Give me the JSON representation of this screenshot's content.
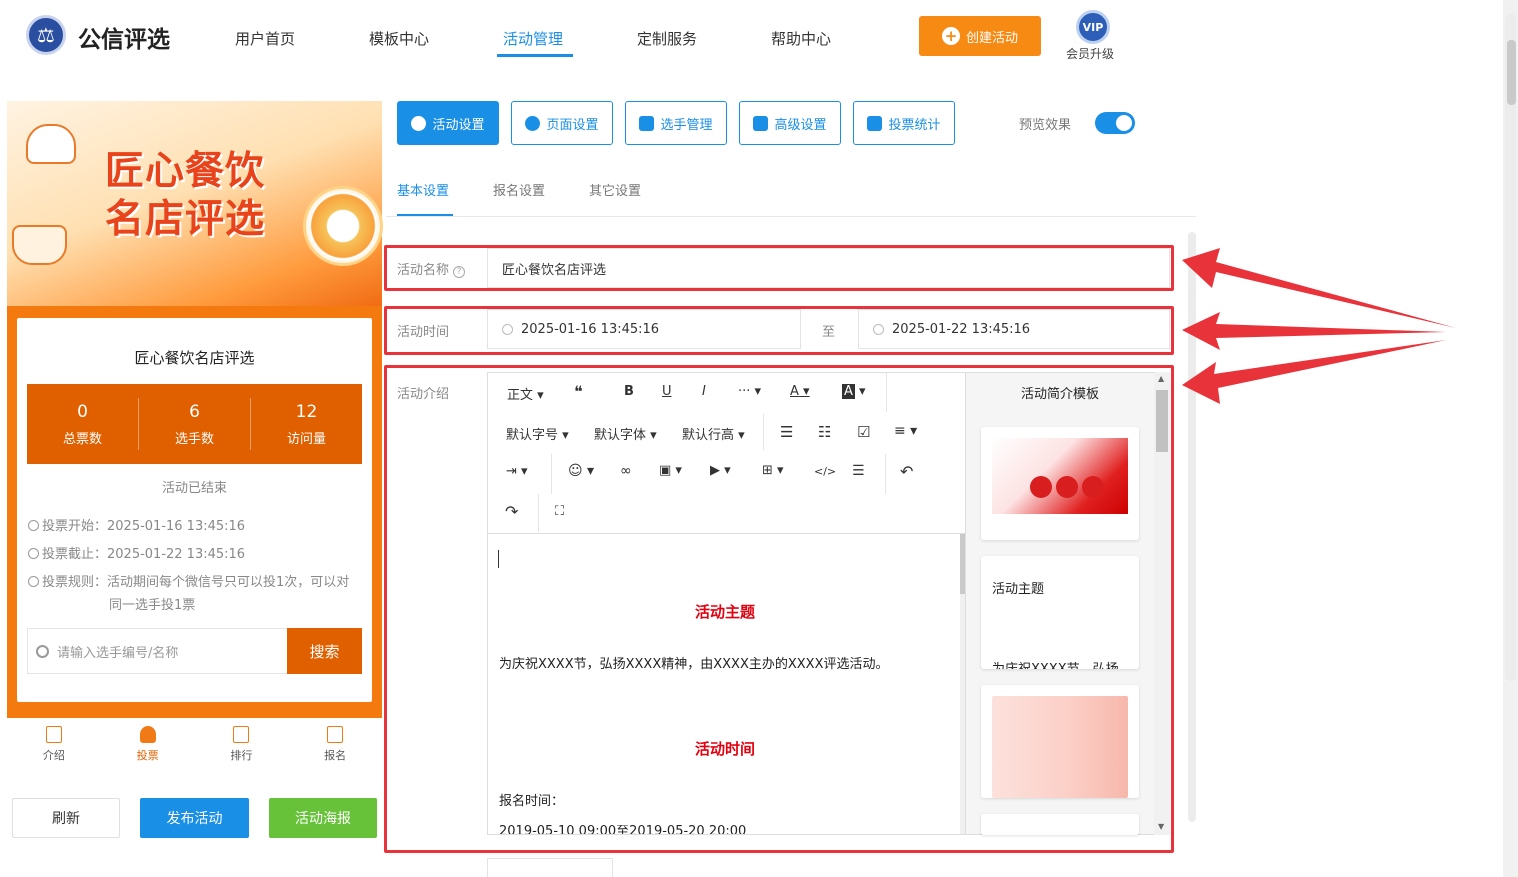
{
  "app": {
    "name": "公信评选",
    "logo_icon": "balance-scale-icon"
  },
  "nav": {
    "items": [
      "用户首页",
      "模板中心",
      "活动管理",
      "定制服务",
      "帮助中心"
    ],
    "active": "活动管理"
  },
  "header": {
    "create_label": "创建活动",
    "vip_badge": "VIP",
    "vip_label": "会员升级"
  },
  "preview": {
    "banner_title_line1": "匠心餐饮",
    "banner_title_line2": "名店评选",
    "activity_name": "匠心餐饮名店评选",
    "stats": [
      {
        "num": "0",
        "label": "总票数"
      },
      {
        "num": "6",
        "label": "选手数"
      },
      {
        "num": "12",
        "label": "访问量"
      }
    ],
    "status": "活动已结束",
    "vote_start": "投票开始：2025-01-16 13:45:16",
    "vote_end": "投票截止：2025-01-22 13:45:16",
    "vote_rule_1": "投票规则：活动期间每个微信号只可以投1次，可以对",
    "vote_rule_2": "同一选手投1票",
    "search_placeholder": "请输入选手编号/名称",
    "search_btn": "搜索",
    "tabs": [
      "介绍",
      "投票",
      "排行",
      "报名"
    ],
    "active_tab": "投票"
  },
  "bottom_buttons": {
    "refresh": "刷新",
    "publish": "发布活动",
    "poster": "活动海报"
  },
  "top_tabs": [
    "活动设置",
    "页面设置",
    "选手管理",
    "高级设置",
    "投票统计"
  ],
  "preview_toggle": {
    "label": "预览效果",
    "on": true
  },
  "sub_tabs": [
    "基本设置",
    "报名设置",
    "其它设置"
  ],
  "form": {
    "name_label": "活动名称",
    "name_value": "匠心餐饮名店评选",
    "time_label": "活动时间",
    "time_start": "2025-01-16 13:45:16",
    "time_sep": "至",
    "time_end": "2025-01-22 13:45:16",
    "intro_label": "活动介绍"
  },
  "editor": {
    "toolbar_row1": [
      "正文",
      "❝",
      "B",
      "U",
      "I",
      "···",
      "A",
      "A"
    ],
    "toolbar_row2": [
      "默认字号",
      "默认字体",
      "默认行高"
    ],
    "content": {
      "heading1": "活动主题",
      "para1": "为庆祝XXXX节，弘扬XXXX精神，由XXXX主办的XXXX评选活动。",
      "heading2": "活动时间",
      "para2": "报名时间：",
      "para3": "2019-05-10 09:00至2019-05-20 20:00"
    }
  },
  "templates": {
    "title": "活动简介模板",
    "card2_title": "活动主题",
    "card2_text": "为庆祝XXXX节，弘扬"
  },
  "colors": {
    "primary": "#1a8fe6",
    "orange": "#f78a13",
    "brand_orange": "#e06000",
    "green": "#67c23a",
    "highlight": "#e8333a"
  }
}
